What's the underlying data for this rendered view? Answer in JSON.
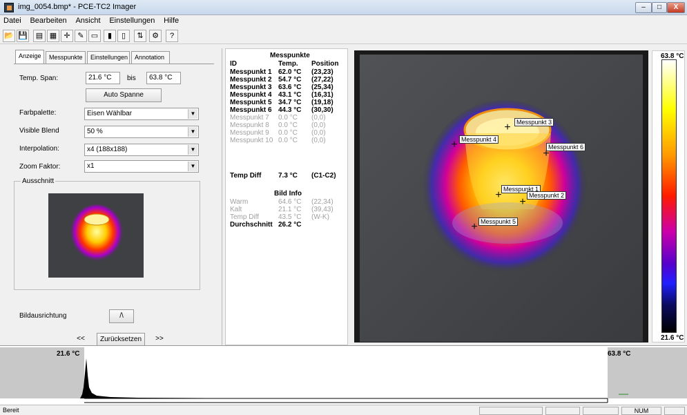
{
  "window": {
    "title": "img_0054.bmp* - PCE-TC2 Imager",
    "buttons": {
      "minimize": "–",
      "maximize": "□",
      "close": "X"
    }
  },
  "menu": [
    "Datei",
    "Bearbeiten",
    "Ansicht",
    "Einstellungen",
    "Hilfe"
  ],
  "toolbar": {
    "icons": [
      "open-icon",
      "save-icon",
      "properties-icon",
      "report-icon",
      "crosshair-icon",
      "marker-icon",
      "rectangle-icon",
      "chart-icon",
      "compare-icon",
      "flip-icon",
      "settings-icon",
      "help-icon"
    ],
    "glyphs": [
      "📂",
      "💾",
      "▤",
      "▦",
      "✛",
      "✎",
      "▭",
      "▮",
      "▯",
      "⇅",
      "⚙",
      "?"
    ]
  },
  "tabs": [
    "Anzeige",
    "Messpunkte",
    "Einstellungen",
    "Annotation"
  ],
  "anzeige": {
    "temp_span_label": "Temp. Span:",
    "temp_min": "21.6 °C",
    "bis": "bis",
    "temp_max": "63.8 °C",
    "auto_button": "Auto Spanne",
    "farbpalette_label": "Farbpalette:",
    "farbpalette_value": "Eisen Wählbar",
    "visible_blend_label": "Visible Blend",
    "visible_blend_value": "50 %",
    "interpolation_label": "Interpolation:",
    "interpolation_value": "x4 (188x188)",
    "zoom_label": "Zoom Faktor:",
    "zoom_value": "x1",
    "ausschnitt_label": "Ausschnitt",
    "bildausrichtung_label": "Bildausrichtung",
    "orientation_button": "/\\",
    "prev_button": "<<",
    "reset_button": "Zurücksetzen",
    "next_button": ">>"
  },
  "messpunkte": {
    "title": "Messpunkte",
    "headers": [
      "ID",
      "Temp.",
      "Position"
    ],
    "rows": [
      {
        "id": "Messpunkt 1",
        "temp": "62.0 °C",
        "pos": "(23,23)",
        "active": true
      },
      {
        "id": "Messpunkt 2",
        "temp": "54.7 °C",
        "pos": "(27,22)",
        "active": true
      },
      {
        "id": "Messpunkt 3",
        "temp": "63.6 °C",
        "pos": "(25,34)",
        "active": true
      },
      {
        "id": "Messpunkt 4",
        "temp": "43.1 °C",
        "pos": "(16,31)",
        "active": true
      },
      {
        "id": "Messpunkt 5",
        "temp": "34.7 °C",
        "pos": "(19,18)",
        "active": true
      },
      {
        "id": "Messpunkt 6",
        "temp": "44.3 °C",
        "pos": "(30,30)",
        "active": true
      },
      {
        "id": "Messpunkt 7",
        "temp": "0.0 °C",
        "pos": "(0,0)",
        "active": false
      },
      {
        "id": "Messpunkt 8",
        "temp": "0.0 °C",
        "pos": "(0,0)",
        "active": false
      },
      {
        "id": "Messpunkt 9",
        "temp": "0.0 °C",
        "pos": "(0,0)",
        "active": false
      },
      {
        "id": "Messpunkt 10",
        "temp": "0.0 °C",
        "pos": "(0,0)",
        "active": false
      }
    ],
    "diff": {
      "label": "Temp Diff",
      "value": "7.3 °C",
      "ref": "(C1-C2)"
    },
    "bildinfo_title": "Bild Info",
    "bildinfo": [
      {
        "label": "Warm",
        "value": "64.6 °C",
        "extra": "(22,34)",
        "bold": false
      },
      {
        "label": "Kalt",
        "value": "21.1 °C",
        "extra": "(39,43)",
        "bold": false
      },
      {
        "label": "Temp Diff",
        "value": "43.5 °C",
        "extra": "(W-K)",
        "bold": false
      },
      {
        "label": "Durchschnitt",
        "value": "26.2 °C",
        "extra": "",
        "bold": true
      }
    ]
  },
  "thermal": {
    "labels": [
      "Messpunkt 3",
      "Messpunkt 4",
      "Messpunkt 6",
      "Messpunkt 1",
      "Messpunkt 2",
      "Messpunkt 5"
    ]
  },
  "colorbar": {
    "max": "63.8 °C",
    "min": "21.6 °C"
  },
  "histogram": {
    "left": "21.6 °C",
    "right": "63.8 °C"
  },
  "status": {
    "text": "Bereit",
    "num": "NUM"
  },
  "colors": {
    "accent": "#2b4f8c",
    "window_bg": "#f0f0f0"
  }
}
